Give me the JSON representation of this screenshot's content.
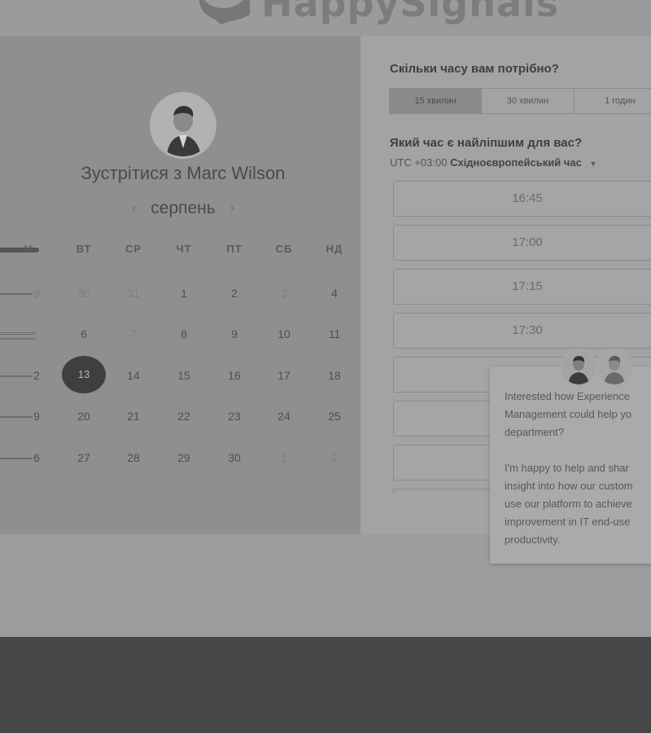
{
  "header": {
    "brand": "HappySignals"
  },
  "calendar": {
    "title": "Зустрітися з Marc Wilson",
    "month": "серпень",
    "prev_icon": "‹",
    "next_icon": "›",
    "weekdays": [
      "ВТ",
      "СР",
      "ЧТ",
      "ПТ",
      "СБ",
      "НД"
    ],
    "weeks": [
      [
        "30",
        "31",
        "1",
        "2",
        "3",
        "4"
      ],
      [
        "6",
        "7",
        "8",
        "9",
        "10",
        "11"
      ],
      [
        "13",
        "14",
        "15",
        "16",
        "17",
        "18"
      ],
      [
        "20",
        "21",
        "22",
        "23",
        "24",
        "25"
      ],
      [
        "27",
        "28",
        "29",
        "30",
        "1",
        "2"
      ]
    ],
    "weekday_first_cut": "Н",
    "first_col_cut": [
      "9",
      "",
      "2",
      "9",
      "6"
    ],
    "selected_day": "13"
  },
  "duration": {
    "question": "Скільки часу вам потрібно?",
    "options": [
      "15 хвилин",
      "30 хвилин",
      "1 годин"
    ],
    "selected": "15 хвилин"
  },
  "time": {
    "question": "Який час є найліпшим для вас?",
    "timezone_offset": "UTC +03:00",
    "timezone_name": "Східноєвропейський час",
    "slots": [
      "16:45",
      "17:00",
      "17:15",
      "17:30",
      "",
      "",
      ""
    ]
  },
  "chat": {
    "message": "Interested how Experience\nManagement could help yo\ndepartment?\n\nI'm happy to help and shar\ninsight into how our custom\nuse our platform to achieve\nimprovement in IT end-use\nproductivity."
  }
}
